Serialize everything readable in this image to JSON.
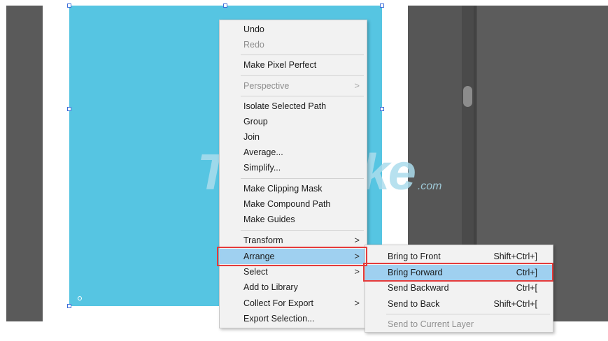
{
  "watermark": {
    "part1": "Tips",
    "part2": "Make",
    "suffix": ".com"
  },
  "context_menu": {
    "undo": "Undo",
    "redo": "Redo",
    "make_pixel_perfect": "Make Pixel Perfect",
    "perspective": "Perspective",
    "isolate_selected_path": "Isolate Selected Path",
    "group": "Group",
    "join": "Join",
    "average": "Average...",
    "simplify": "Simplify...",
    "make_clipping_mask": "Make Clipping Mask",
    "make_compound_path": "Make Compound Path",
    "make_guides": "Make Guides",
    "transform": "Transform",
    "arrange": "Arrange",
    "select": "Select",
    "add_to_library": "Add to Library",
    "collect_for_export": "Collect For Export",
    "export_selection": "Export Selection...",
    "submenu_arrow": ">"
  },
  "arrange_submenu": {
    "bring_to_front": {
      "label": "Bring to Front",
      "shortcut": "Shift+Ctrl+]"
    },
    "bring_forward": {
      "label": "Bring Forward",
      "shortcut": "Ctrl+]"
    },
    "send_backward": {
      "label": "Send Backward",
      "shortcut": "Ctrl+["
    },
    "send_to_back": {
      "label": "Send to Back",
      "shortcut": "Shift+Ctrl+["
    },
    "send_to_current_layer": {
      "label": "Send to Current Layer"
    }
  },
  "colors": {
    "shape_fill": "#56c5e2",
    "highlight": "#9fd0f0",
    "annotation": "#e53b3b"
  }
}
